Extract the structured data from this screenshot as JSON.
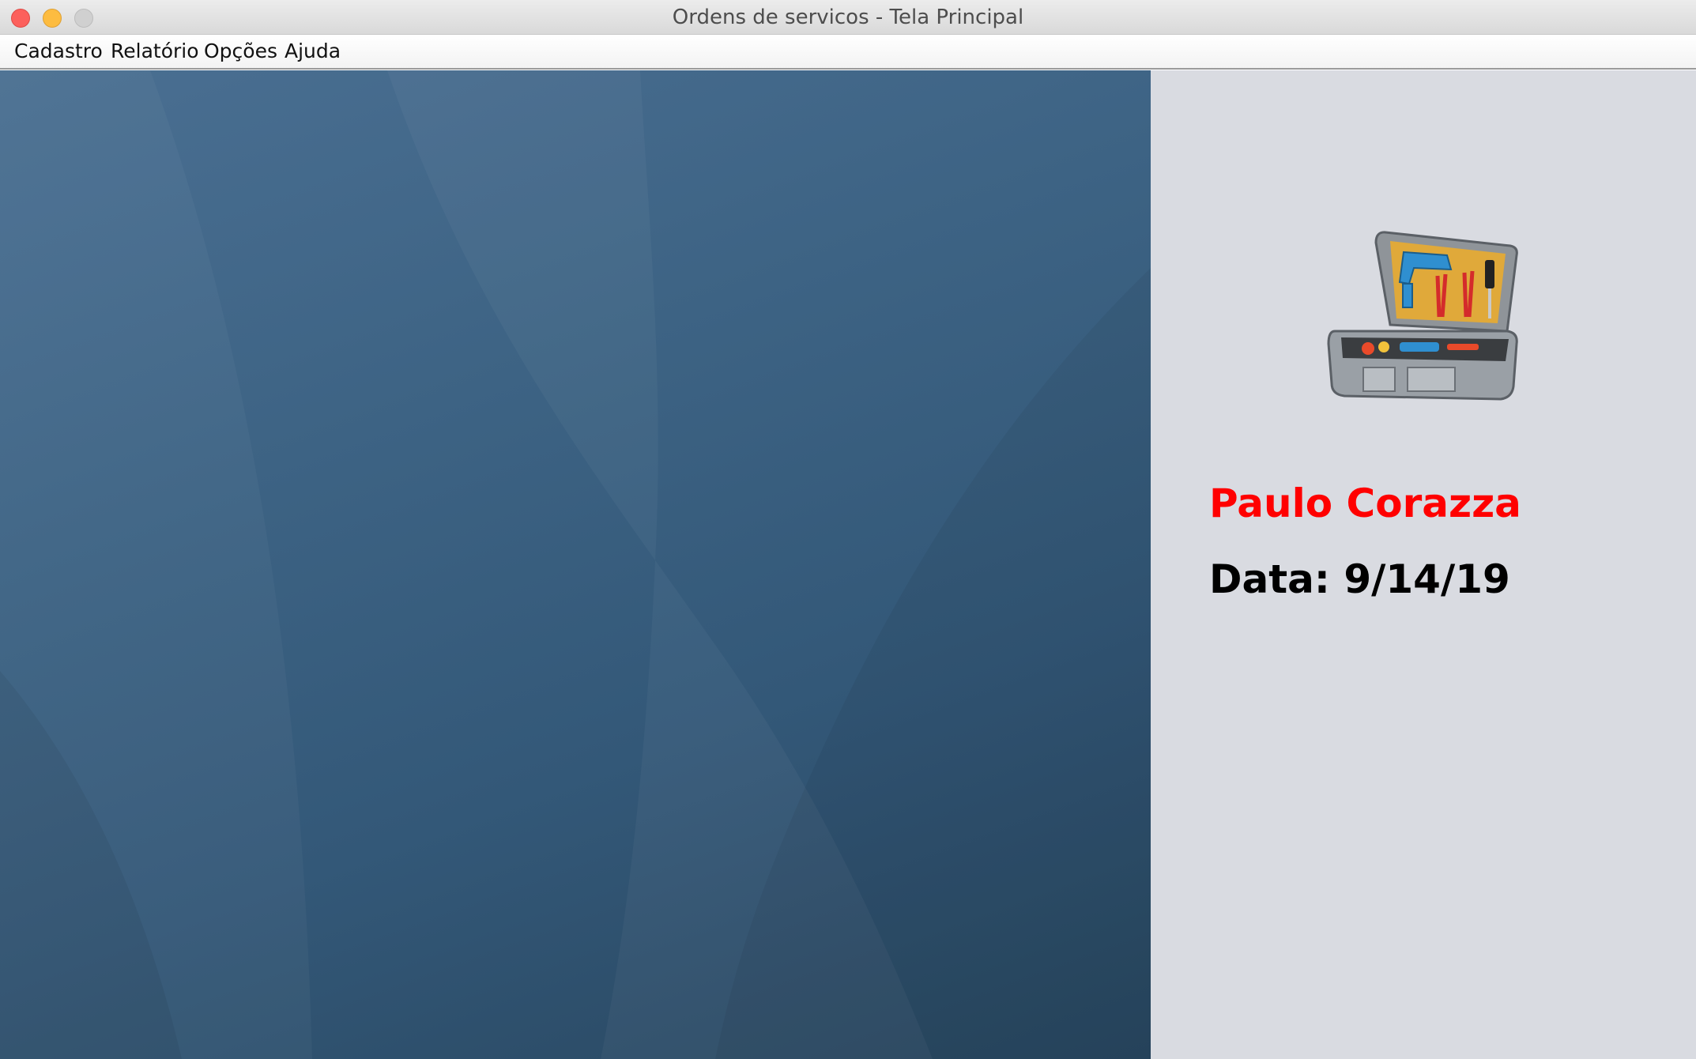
{
  "window": {
    "title": "Ordens de servicos - Tela Principal"
  },
  "menubar": {
    "items": [
      {
        "label": "Cadastro"
      },
      {
        "label": "Relatório"
      },
      {
        "label": "Opções"
      },
      {
        "label": "Ajuda"
      }
    ]
  },
  "sidepanel": {
    "icon": "toolbox-icon",
    "user_name": "Paulo Corazza",
    "date_label": "Data:",
    "date_value": "9/14/19"
  },
  "colors": {
    "user_name": "#ff0000",
    "desktop_background": "#3d6384",
    "sidepanel_background": "#d9dbe1"
  }
}
